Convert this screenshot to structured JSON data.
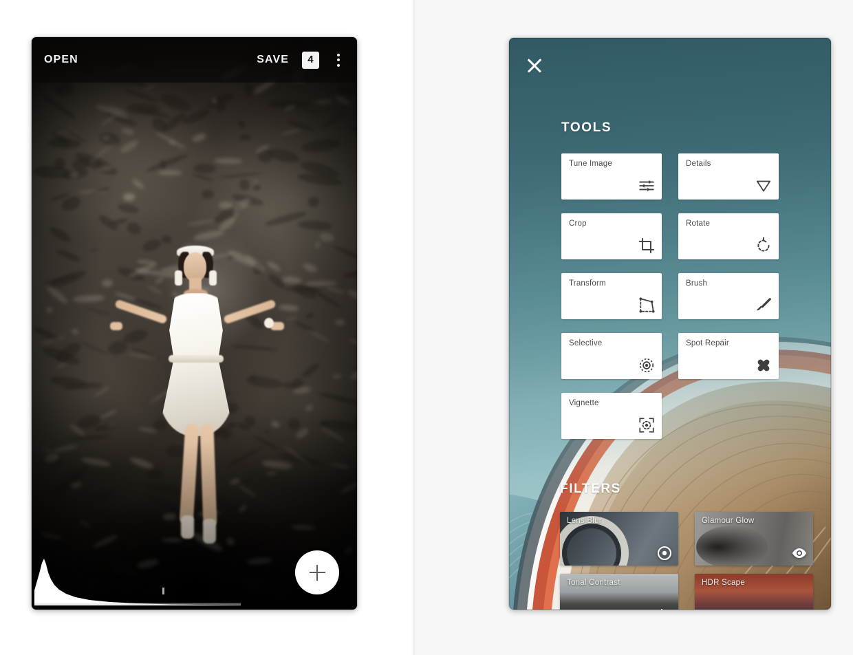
{
  "left_panel": {
    "name": "photo-editor-screen",
    "topbar": {
      "open_label": "OPEN",
      "save_label": "SAVE",
      "count_badge": "4",
      "overflow_icon": "kebab-menu-icon"
    },
    "photo": {
      "description": "woman-in-white-dress-on-rock",
      "histogram_icon": "histogram-overlay"
    },
    "fab": {
      "icon": "plus-icon",
      "label": "+"
    }
  },
  "right_panel": {
    "name": "tools-and-filters-screen",
    "close_icon": "close-x-icon",
    "tools_heading": "TOOLS",
    "filters_heading": "FILTERS",
    "tools": [
      {
        "label": "Tune Image",
        "icon": "sliders-icon"
      },
      {
        "label": "Details",
        "icon": "triangle-down-icon"
      },
      {
        "label": "Crop",
        "icon": "crop-icon"
      },
      {
        "label": "Rotate",
        "icon": "rotate-icon"
      },
      {
        "label": "Transform",
        "icon": "transform-icon"
      },
      {
        "label": "Brush",
        "icon": "brush-icon"
      },
      {
        "label": "Selective",
        "icon": "selective-target-icon"
      },
      {
        "label": "Spot Repair",
        "icon": "bandage-icon"
      },
      {
        "label": "Vignette",
        "icon": "vignette-icon"
      }
    ],
    "filters": [
      {
        "label": "Lens Blur",
        "icon": "lens-circle-icon"
      },
      {
        "label": "Glamour Glow",
        "icon": "eye-icon"
      },
      {
        "label": "Tonal Contrast",
        "icon": "waveform-icon"
      },
      {
        "label": "HDR Scape",
        "icon": "mountain-icon"
      }
    ],
    "background_image": "curved-architecture-orange-teal"
  },
  "colors": {
    "panel_gradient_top": "#4b7782",
    "panel_gradient_bottom": "#bcd9da",
    "card_white": "#ffffff",
    "text_dark": "#4a4a4a",
    "text_light": "#ffffff",
    "page_background": "#ffffff",
    "right_wash": "#f7f7f7",
    "fab_white": "#ffffff",
    "topbar_black": "#0a0807",
    "accent_orange": "#e0714c"
  }
}
